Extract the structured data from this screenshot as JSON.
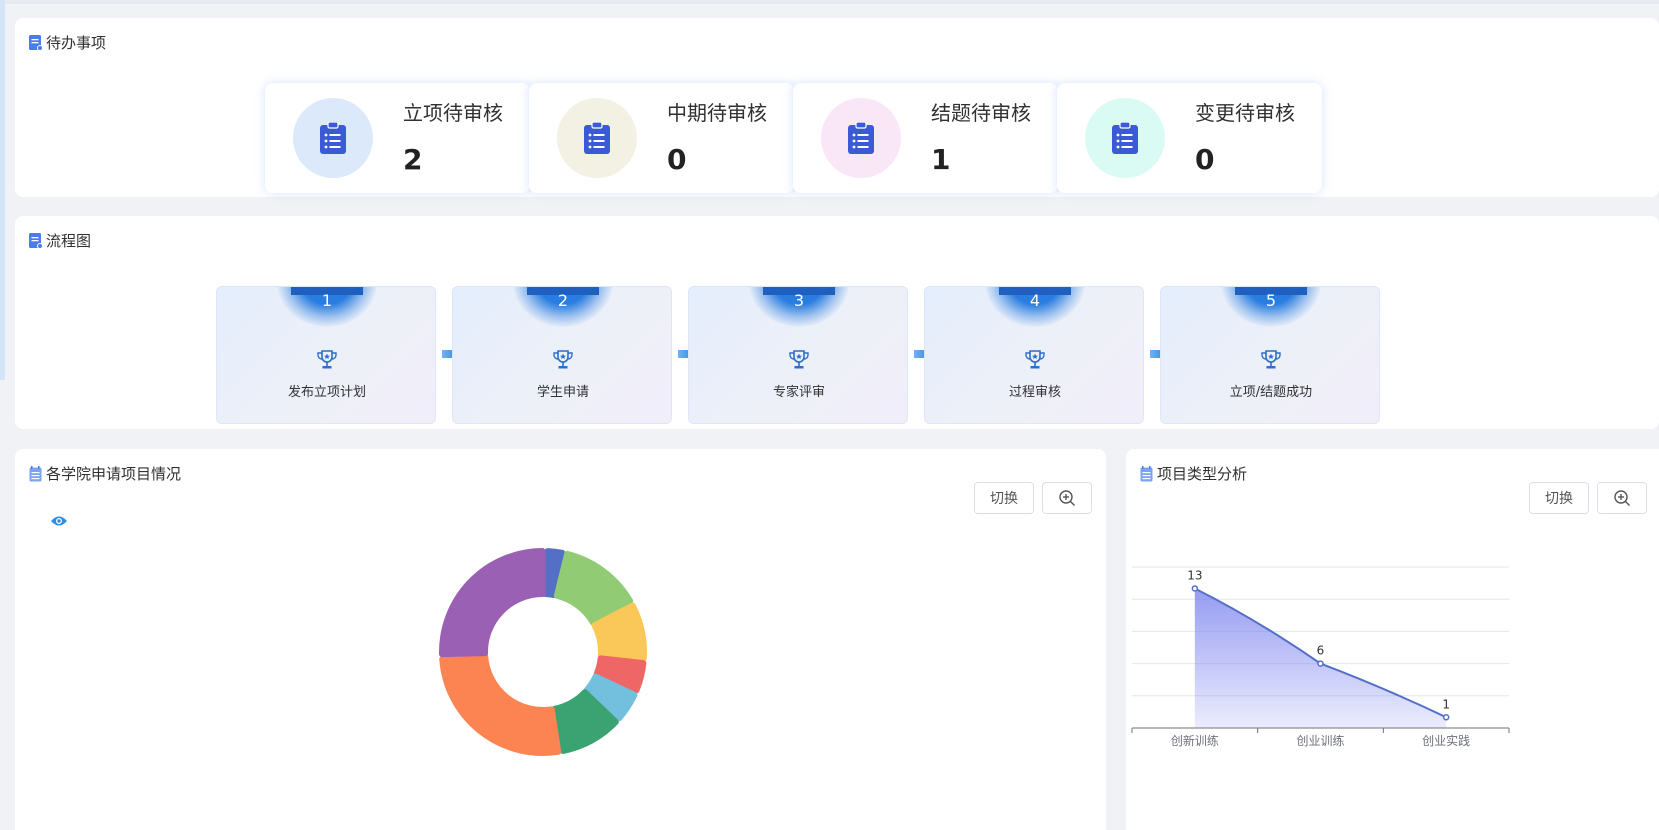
{
  "todo": {
    "title": "待办事项",
    "items": [
      {
        "label": "立项待审核",
        "count": "2",
        "color": "#dce9fb"
      },
      {
        "label": "中期待审核",
        "count": "0",
        "color": "#f3f1e3"
      },
      {
        "label": "结题待审核",
        "count": "1",
        "color": "#f9e6f7"
      },
      {
        "label": "变更待审核",
        "count": "0",
        "color": "#dafbf4"
      }
    ]
  },
  "flow": {
    "title": "流程图",
    "steps": [
      {
        "num": "1",
        "label": "发布立项计划"
      },
      {
        "num": "2",
        "label": "学生申请"
      },
      {
        "num": "3",
        "label": "专家评审"
      },
      {
        "num": "4",
        "label": "过程审核"
      },
      {
        "num": "5",
        "label": "立项/结题成功"
      }
    ]
  },
  "college": {
    "title": "各学院申请项目情况",
    "switch_label": "切换",
    "zoom_icon": "zoom-in-icon",
    "eye_icon": "eye-icon"
  },
  "type_analysis": {
    "title": "项目类型分析",
    "switch_label": "切换",
    "zoom_icon": "zoom-in-icon"
  },
  "chart_data": [
    {
      "type": "pie",
      "donut": true,
      "slices": [
        {
          "value": 3,
          "color": "#5470c6"
        },
        {
          "value": 13,
          "color": "#91cc75"
        },
        {
          "value": 9,
          "color": "#fac858"
        },
        {
          "value": 5,
          "color": "#ee6666"
        },
        {
          "value": 5,
          "color": "#73c0de"
        },
        {
          "value": 10,
          "color": "#3ba272"
        },
        {
          "value": 26,
          "color": "#fc8452"
        },
        {
          "value": 25,
          "color": "#9a60b4"
        }
      ]
    },
    {
      "type": "area",
      "categories": [
        "创新训练",
        "创业训练",
        "创业实践"
      ],
      "values": [
        13,
        6,
        1
      ],
      "ylim": [
        0,
        15
      ],
      "yticks": [
        "0",
        "3",
        "6",
        "9",
        "12",
        "15"
      ],
      "grid": true,
      "line_color": "#5470c6",
      "fill_color": "#7b83ee"
    }
  ]
}
